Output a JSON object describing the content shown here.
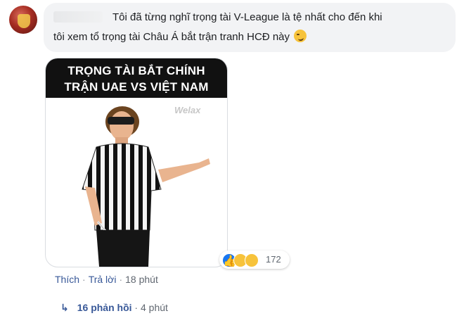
{
  "comment": {
    "text_line1": "Tôi đã từng nghĩ trọng tài V-League là tệ nhất cho đến khi",
    "text_line2": "tôi xem tổ trọng tài Châu Á bắt trận tranh HCĐ này",
    "emoji": "smirk-emoji"
  },
  "meme": {
    "caption_line1": "TRỌNG TÀI BẮT CHÍNH",
    "caption_line2": "TRẬN UAE VS VIỆT NAM",
    "watermark": "Welax"
  },
  "reactions": {
    "icons": [
      "like-icon",
      "haha-icon",
      "sad-icon"
    ],
    "count": "172",
    "colors": {
      "like": "#1877f2",
      "emoji": "#f7c33b"
    }
  },
  "actions": {
    "like_label": "Thích",
    "reply_label": "Trả lời",
    "time": "18 phút"
  },
  "replies": {
    "label": "16 phản hồi",
    "time": "4 phút"
  },
  "colors": {
    "link": "#385898",
    "bubble_bg": "#f2f3f5",
    "meta": "#606770"
  }
}
